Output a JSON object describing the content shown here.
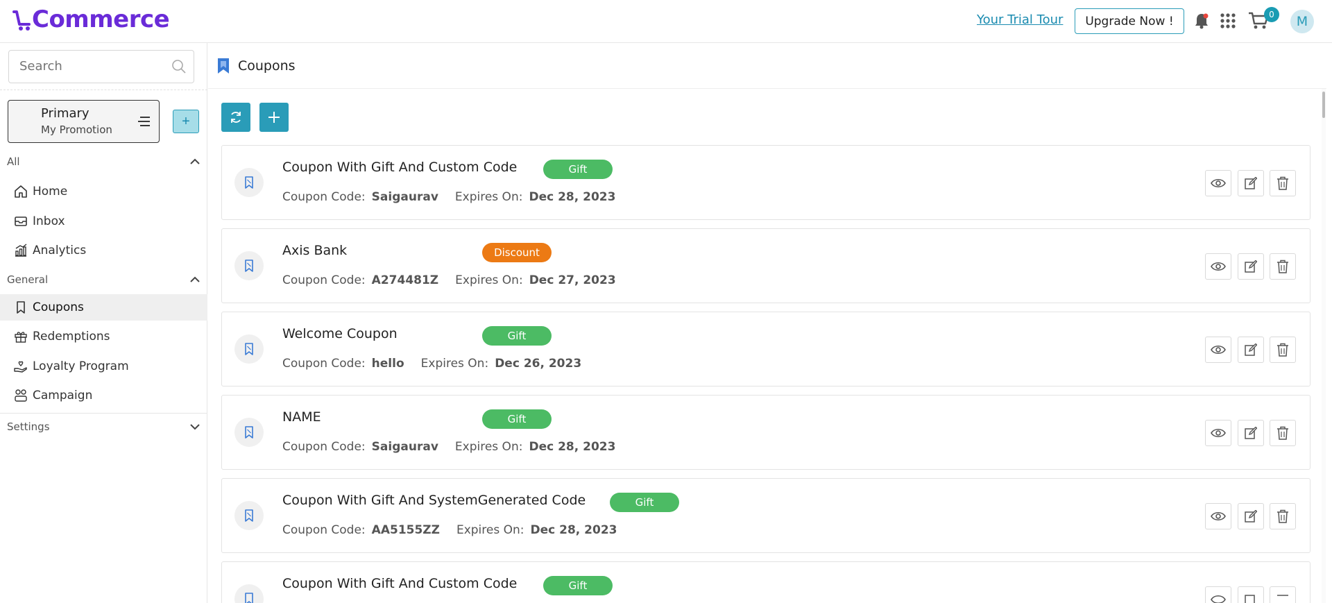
{
  "header": {
    "logo_text": "Commerce",
    "trial_link": "Your Trial Tour",
    "upgrade_label": "Upgrade Now !",
    "cart_count": "0",
    "avatar_initial": "M",
    "colors": {
      "brand": "#6a2bd8",
      "accent": "#2a9cb8"
    }
  },
  "sidebar": {
    "search_placeholder": "Search",
    "workspace": {
      "title": "Primary",
      "subtitle": "My Promotion"
    },
    "add_label": "+",
    "sections": [
      {
        "label": "All",
        "items": [
          {
            "label": "Home",
            "icon": "home-icon"
          },
          {
            "label": "Inbox",
            "icon": "inbox-icon"
          },
          {
            "label": "Analytics",
            "icon": "analytics-icon"
          }
        ]
      },
      {
        "label": "General",
        "items": [
          {
            "label": "Coupons",
            "icon": "coupon-icon",
            "active": true
          },
          {
            "label": "Redemptions",
            "icon": "gift-icon"
          },
          {
            "label": "Loyalty Program",
            "icon": "loyalty-icon"
          },
          {
            "label": "Campaign",
            "icon": "campaign-icon"
          }
        ]
      },
      {
        "label": "Settings",
        "items": []
      }
    ]
  },
  "main": {
    "title": "Coupons",
    "labels": {
      "code": "Coupon Code:",
      "expires": "Expires On:"
    },
    "coupons": [
      {
        "name": "Coupon With Gift And Custom Code",
        "badge": "Gift",
        "code": "Saigaurav",
        "expires": "Dec 28, 2023"
      },
      {
        "name": "Axis Bank",
        "badge": "Discount",
        "code": "A274481Z",
        "expires": "Dec 27, 2023"
      },
      {
        "name": "Welcome Coupon",
        "badge": "Gift",
        "code": "hello",
        "expires": "Dec 26, 2023"
      },
      {
        "name": "NAME",
        "badge": "Gift",
        "code": "Saigaurav",
        "expires": "Dec 28, 2023"
      },
      {
        "name": "Coupon With Gift And SystemGenerated Code",
        "badge": "Gift",
        "code": "AA5155ZZ",
        "expires": "Dec 28, 2023"
      },
      {
        "name": "Coupon With Gift And Custom Code",
        "badge": "Gift",
        "code": "",
        "expires": ""
      }
    ]
  }
}
